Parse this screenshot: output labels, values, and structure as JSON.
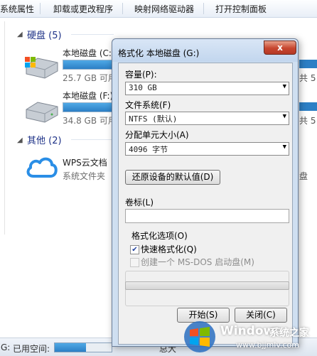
{
  "toolbar": {
    "items": [
      "系统属性",
      "卸载或更改程序",
      "映射网络驱动器",
      "打开控制面板"
    ]
  },
  "groups": {
    "hard_disk": "硬盘 (5)",
    "other": "其他 (2)"
  },
  "drives": [
    {
      "name": "本地磁盘 (C:",
      "free": "25.7 GB 可用",
      "fill": 0.55
    },
    {
      "name": "本地磁盘 (F:)",
      "free": "34.8 GB 可用",
      "fill": 0.6
    }
  ],
  "wps": {
    "name": "WPS云文档",
    "type": "系统文件夹"
  },
  "right_clip": {
    "row1": "共 5",
    "row2": "共 5",
    "other": "盘"
  },
  "status": {
    "used_label": "已用空间:",
    "total_label": "总大",
    "left_char": "G:"
  },
  "dialog": {
    "title": "格式化 本地磁盘 (G:)",
    "close_symbol": "x",
    "capacity_label": "容量(P):",
    "capacity_value": "310 GB",
    "filesystem_label": "文件系统(F)",
    "filesystem_value": "NTFS (默认)",
    "alloc_label": "分配单元大小(A)",
    "alloc_value": "4096 字节",
    "restore_button": "还原设备的默认值(D)",
    "volume_label": "卷标(L)",
    "volume_value": "",
    "options_label": "格式化选项(O)",
    "quick_format": "快速格式化(Q)",
    "quick_format_checked": true,
    "msdos_disk": "创建一个 MS-DOS 启动盘(M)",
    "msdos_checked": false,
    "progress": 0,
    "start_button": "开始(S)",
    "close_button": "关闭(C)"
  },
  "watermark": {
    "brand": "Windows",
    "brand_cn": "系统之家",
    "url": "www.bjjmlv.com"
  },
  "colors": {
    "accent": "#2c7fc5",
    "group_title": "#1e3287",
    "dialog_frame": "#cfdff1"
  }
}
